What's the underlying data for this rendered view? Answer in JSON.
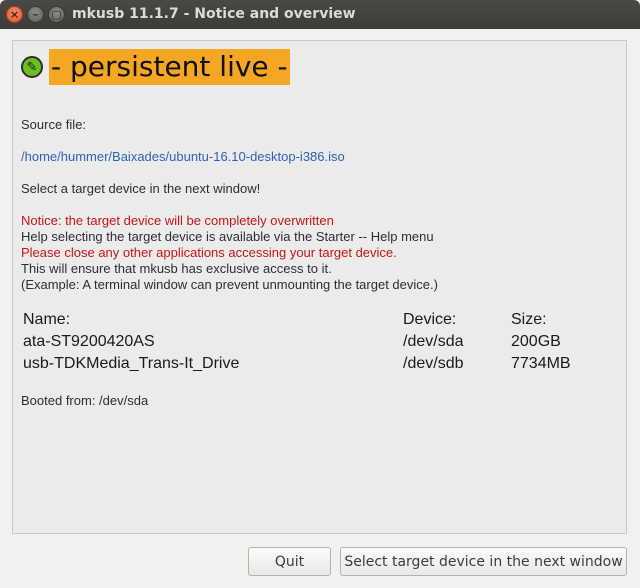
{
  "window": {
    "title": "mkusb 11.1.7 - Notice and overview",
    "close_glyph": "×",
    "minimize_glyph": "–",
    "maximize_glyph": "▢"
  },
  "banner": {
    "text": "- persistent live -",
    "logo_glyph": "✎"
  },
  "source": {
    "label": "Source file:",
    "path": "/home/hummer/Baixades/ubuntu-16.10-desktop-i386.iso"
  },
  "instructions": {
    "select_target": "Select a target device in the next window!",
    "notice_overwrite": "Notice: the target device will be completely overwritten",
    "help_info": "Help selecting the target device is available via the Starter -- Help menu",
    "close_apps": "Please close any other applications accessing your target device.",
    "exclusive_access": "This will ensure that mkusb has exclusive access to it.",
    "example": "(Example: A terminal window can prevent unmounting the target device.)"
  },
  "devices": {
    "headers": {
      "name": "Name:",
      "device": "Device:",
      "size": "Size:"
    },
    "rows": [
      {
        "name": "ata-ST9200420AS",
        "device": "/dev/sda",
        "size": "200GB"
      },
      {
        "name": "usb-TDKMedia_Trans-It_Drive",
        "device": "/dev/sdb",
        "size": "7734MB"
      }
    ]
  },
  "booted_from": "Booted from: /dev/sda",
  "buttons": {
    "quit": "Quit",
    "select": "Select target device in the next window"
  },
  "colors": {
    "banner_bg": "#f5a623",
    "warning": "#c81414",
    "link": "#2b63b5",
    "logo": "#6bc01f"
  }
}
